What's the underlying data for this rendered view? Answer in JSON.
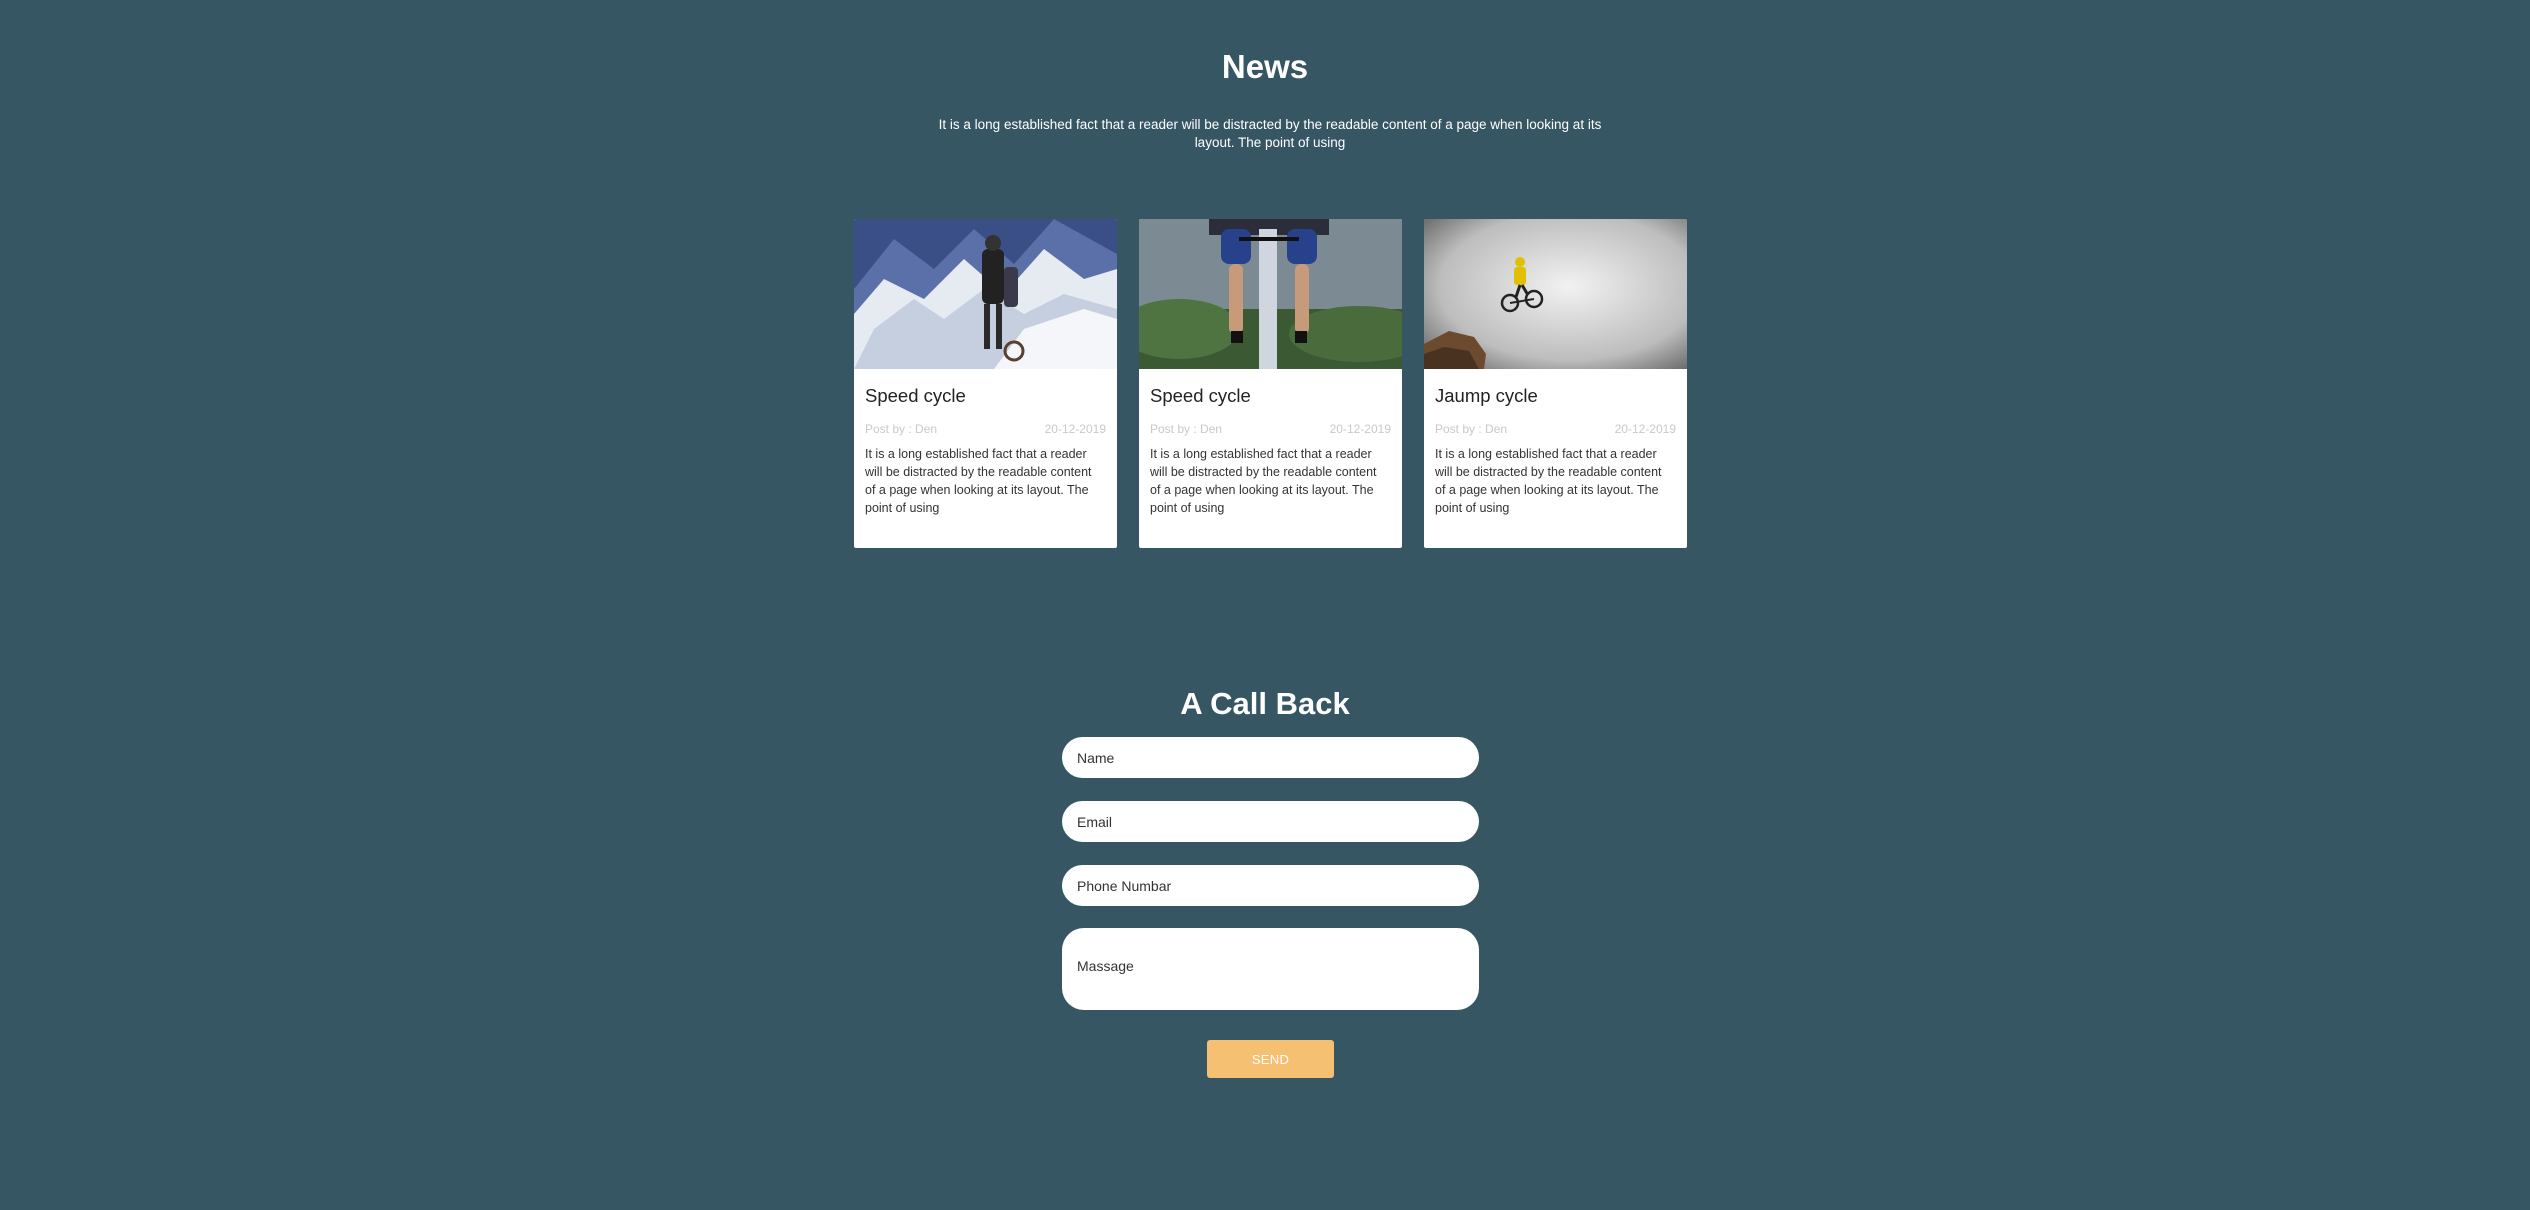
{
  "news": {
    "title": "News",
    "subtitle": "It is a long established fact that a reader will be distracted by the readable content of a page when looking at its layout. The point of using",
    "cards": [
      {
        "title": "Speed cycle",
        "author": "Post by : Den",
        "date": "20-12-2019",
        "text": "It is a long established fact that a reader will be distracted by the readable content of a page when looking at its layout. The point of using"
      },
      {
        "title": "Speed cycle",
        "author": "Post by : Den",
        "date": "20-12-2019",
        "text": "It is a long established fact that a reader will be distracted by the readable content of a page when looking at its layout. The point of using"
      },
      {
        "title": "Jaump cycle",
        "author": "Post by : Den",
        "date": "20-12-2019",
        "text": "It is a long established fact that a reader will be distracted by the readable content of a page when looking at its layout. The point of using"
      }
    ]
  },
  "callback": {
    "title": "A Call Back",
    "name_placeholder": "Name",
    "email_placeholder": "Email",
    "phone_placeholder": "Phone Numbar",
    "message_placeholder": "Massage",
    "send_label": "SEND"
  },
  "colors": {
    "background": "#375663",
    "button": "#f6c072",
    "card": "#ffffff"
  }
}
